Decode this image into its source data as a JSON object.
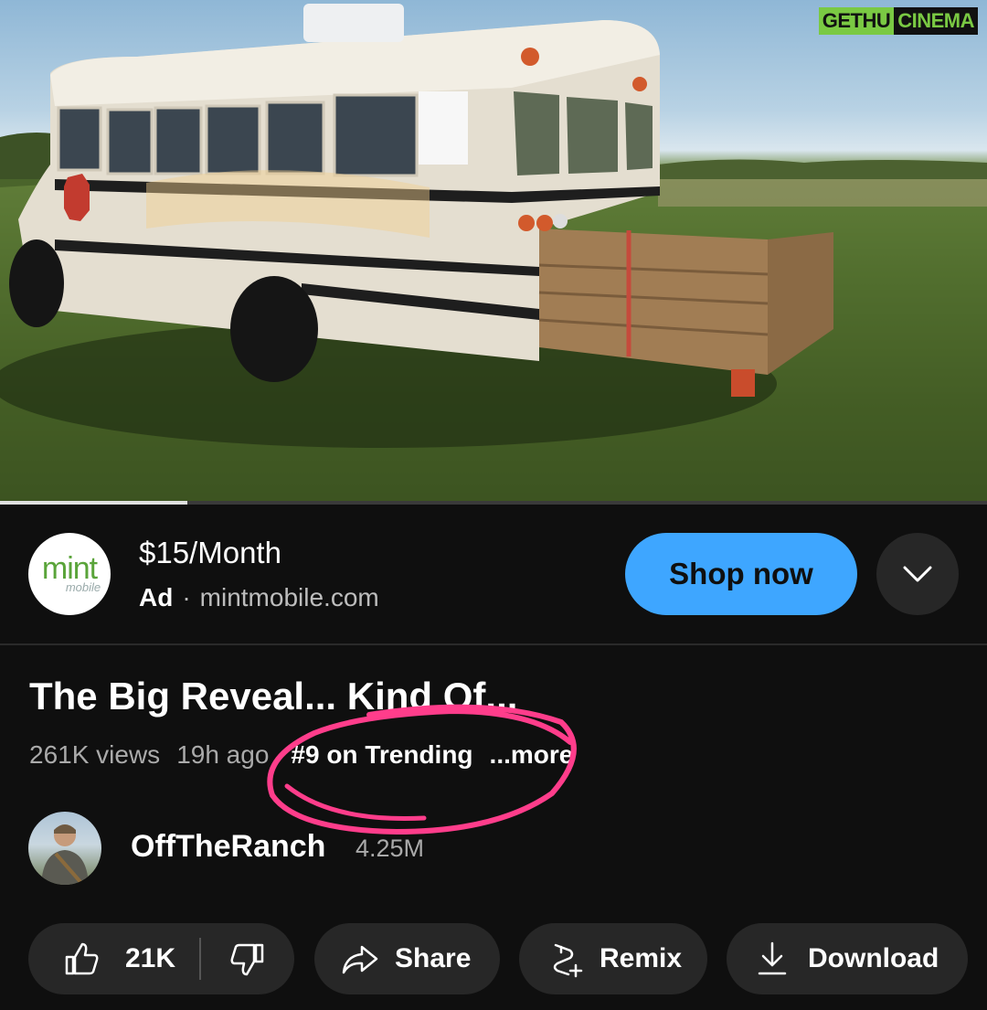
{
  "watermark": {
    "part1": "GETHU",
    "part2": "CINEMA"
  },
  "video": {
    "progress_fraction": 0.19
  },
  "ad": {
    "logo_text": "mint",
    "logo_subtext": "mobile",
    "title": "$15/Month",
    "tag": "Ad",
    "separator": "·",
    "domain": "mintmobile.com",
    "cta_label": "Shop now"
  },
  "video_info": {
    "title": "The Big Reveal... Kind Of...",
    "views": "261K views",
    "age": "19h ago",
    "trending": "#9 on Trending",
    "more": "...more"
  },
  "channel": {
    "name": "OffTheRanch",
    "subscribers": "4.25M"
  },
  "actions": {
    "likes": "21K",
    "share": "Share",
    "remix": "Remix",
    "download": "Download"
  },
  "colors": {
    "background": "#0f0f0f",
    "accent": "#3ea6ff",
    "pill": "#272727",
    "annotation": "#ff3d8b"
  },
  "icons": [
    "thumbs-up-icon",
    "thumbs-down-icon",
    "share-icon",
    "remix-icon",
    "download-icon",
    "chevron-down-icon"
  ]
}
